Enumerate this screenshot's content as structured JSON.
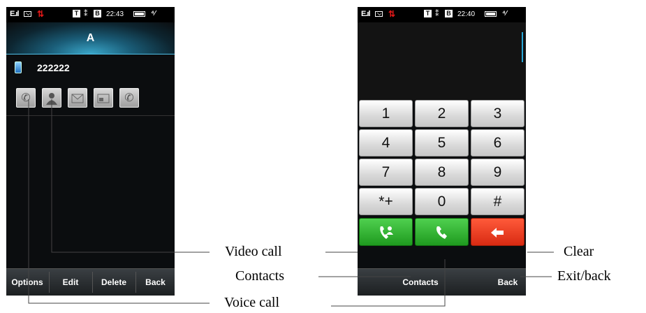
{
  "left_phone": {
    "status": {
      "signal": "E.ıl",
      "time": "22:43"
    },
    "title": "A",
    "number": "222222",
    "actions": [
      "voice-call",
      "video-call",
      "message",
      "mms",
      "call-forward"
    ],
    "softkeys": [
      "Options",
      "Edit",
      "Delete",
      "Back"
    ]
  },
  "right_phone": {
    "status": {
      "signal": "E.ıl",
      "time": "22:40"
    },
    "keys": [
      "1",
      "2",
      "3",
      "4",
      "5",
      "6",
      "7",
      "8",
      "9",
      "*+",
      "0",
      "#"
    ],
    "softkeys": {
      "contacts": "Contacts",
      "back": "Back"
    }
  },
  "annotations": {
    "video_call": "Video call",
    "contacts": "Contacts",
    "voice_call": "Voice call",
    "clear": "Clear",
    "exit_back": "Exit/back"
  }
}
